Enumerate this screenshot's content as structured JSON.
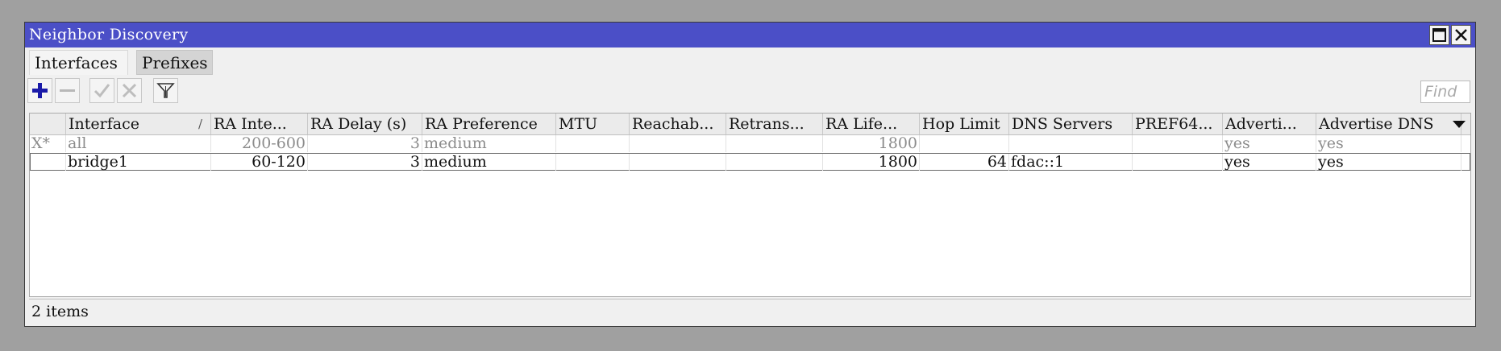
{
  "window": {
    "title": "Neighbor Discovery"
  },
  "tabs": [
    {
      "label": "Interfaces"
    },
    {
      "label": "Prefixes"
    }
  ],
  "toolbar": {
    "add": "add-icon",
    "remove": "remove-icon",
    "enable": "check-icon",
    "disable": "cross-icon",
    "filter": "filter-icon",
    "find_placeholder": "Find"
  },
  "table": {
    "columns": [
      "",
      "Interface",
      "RA Inte...",
      "RA Delay (s)",
      "RA Preference",
      "MTU",
      "Reachab...",
      "Retrans...",
      "RA Life...",
      "Hop Limit",
      "DNS Servers",
      "PREF64...",
      "Adverti...",
      "Advertise DNS"
    ],
    "sort_indicator": "/",
    "rows": [
      {
        "flags": "X*",
        "interface": "all",
        "ra_interval": "200-600",
        "ra_delay": "3",
        "ra_preference": "medium",
        "mtu": "",
        "reachable": "",
        "retrans": "",
        "ra_lifetime": "1800",
        "hop_limit": "",
        "dns_servers": "",
        "pref64": "",
        "advertise_mac": "yes",
        "advertise_dns": "yes",
        "disabled": true
      },
      {
        "flags": "",
        "interface": "bridge1",
        "ra_interval": "60-120",
        "ra_delay": "3",
        "ra_preference": "medium",
        "mtu": "",
        "reachable": "",
        "retrans": "",
        "ra_lifetime": "1800",
        "hop_limit": "64",
        "dns_servers": "fdac::1",
        "pref64": "",
        "advertise_mac": "yes",
        "advertise_dns": "yes",
        "disabled": false
      }
    ]
  },
  "status": {
    "count": "2 items"
  },
  "colors": {
    "titlebar": "#4b4fc7",
    "add_icon": "#1a1aa8",
    "background": "#a0a0a0"
  }
}
